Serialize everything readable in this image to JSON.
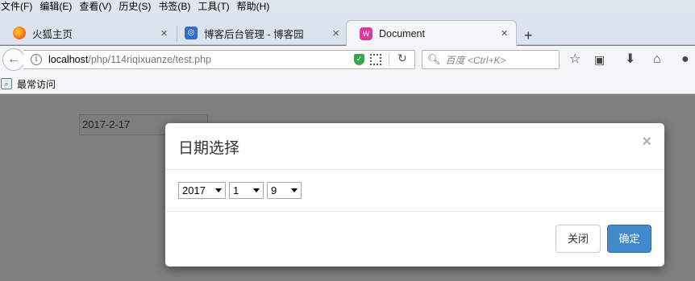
{
  "menubar": {
    "items": [
      "文件(F)",
      "编辑(E)",
      "查看(V)",
      "历史(S)",
      "书签(B)",
      "工具(T)",
      "帮助(H)"
    ]
  },
  "tabs": [
    {
      "title": "火狐主页",
      "icon": "firefox-icon"
    },
    {
      "title": "博客后台管理 - 博客园",
      "icon": "cnblogs-icon"
    },
    {
      "title": "Document",
      "icon": "document-icon",
      "active": true
    }
  ],
  "navbar": {
    "url_host": "localhost",
    "url_path": "/php/114riqixuanze/test.php",
    "search_placeholder": "百度 <Ctrl+K>"
  },
  "bookmarks": {
    "label": "最常访问"
  },
  "page": {
    "date_value": "2017-2-17"
  },
  "modal": {
    "title": "日期选择",
    "close_glyph": "×",
    "year": "2017",
    "month": "1",
    "day": "9",
    "cancel_label": "关闭",
    "confirm_label": "确定"
  },
  "colors": {
    "primary_button": "#428bca",
    "overlay": "#808080"
  }
}
